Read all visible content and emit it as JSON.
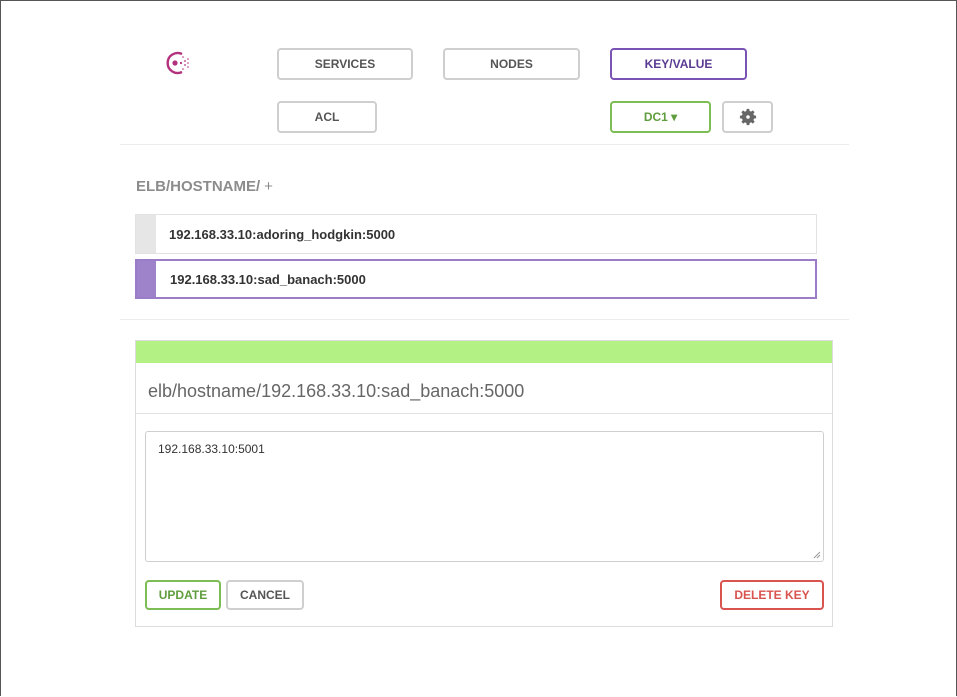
{
  "nav": {
    "services": "SERVICES",
    "nodes": "NODES",
    "keyvalue": "KEY/VALUE",
    "acl": "ACL",
    "datacenter": "DC1 ▾"
  },
  "breadcrumb": {
    "path": "ELB/HOSTNAME/",
    "add": "+"
  },
  "keys": [
    {
      "label": "192.168.33.10:adoring_hodgkin:5000",
      "selected": false
    },
    {
      "label": "192.168.33.10:sad_banach:5000",
      "selected": true
    }
  ],
  "editor": {
    "title": "elb/hostname/192.168.33.10:sad_banach:5000",
    "value": "192.168.33.10:5001",
    "update_label": "UPDATE",
    "cancel_label": "CANCEL",
    "delete_label": "DELETE KEY",
    "header_color": "#b3f184"
  },
  "colors": {
    "accent_purple": "#7a54b4",
    "accent_green": "#7dbd55",
    "danger_red": "#d9534f"
  },
  "icons": {
    "logo": "consul-logo-icon",
    "settings": "gear-icon"
  }
}
